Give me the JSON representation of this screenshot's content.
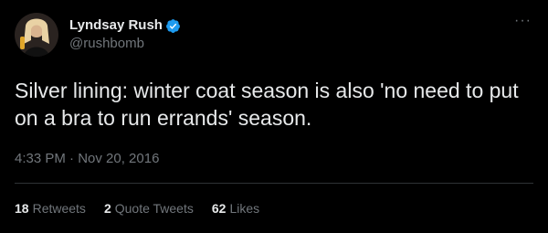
{
  "author": {
    "display_name": "Lyndsay Rush",
    "handle": "@rushbomb",
    "verified": true,
    "avatar_icon": "avatar"
  },
  "menu_icon": "more-icon",
  "tweet": {
    "text": "Silver lining: winter coat season is also 'no need to put on a bra to run errands' season.",
    "timestamp": "4:33 PM · Nov 20, 2016"
  },
  "stats": {
    "retweets": {
      "count": "18",
      "label": "Retweets"
    },
    "quote_tweets": {
      "count": "2",
      "label": "Quote Tweets"
    },
    "likes": {
      "count": "62",
      "label": "Likes"
    }
  },
  "colors": {
    "background": "#000000",
    "text_primary": "#e7e9ea",
    "text_secondary": "#71767b",
    "verified_blue": "#1d9bf0",
    "divider": "#2f3336"
  }
}
